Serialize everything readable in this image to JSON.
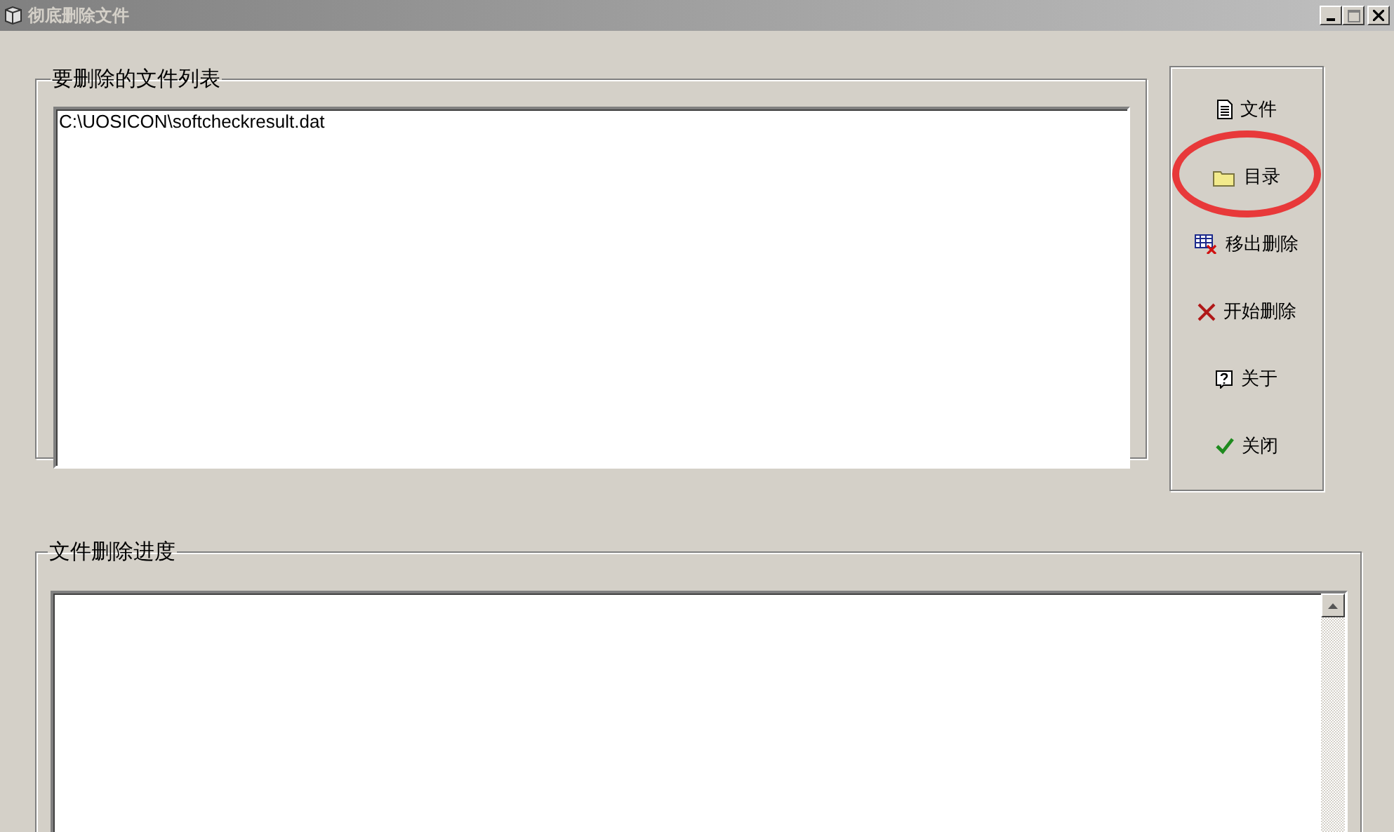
{
  "window": {
    "title": "彻底删除文件",
    "active": false
  },
  "file_list": {
    "legend": "要删除的文件列表",
    "items": [
      "C:\\UOSICON\\softcheckresult.dat"
    ]
  },
  "buttons": [
    {
      "kind": "file",
      "label": "文件",
      "circled": false
    },
    {
      "kind": "folder",
      "label": "目录",
      "circled": true
    },
    {
      "kind": "remove",
      "label": "移出删除",
      "circled": false
    },
    {
      "kind": "delete",
      "label": "开始删除",
      "circled": false
    },
    {
      "kind": "about",
      "label": "关于",
      "circled": false
    },
    {
      "kind": "close",
      "label": "关闭",
      "circled": false
    }
  ],
  "progress": {
    "legend": "文件删除进度"
  }
}
